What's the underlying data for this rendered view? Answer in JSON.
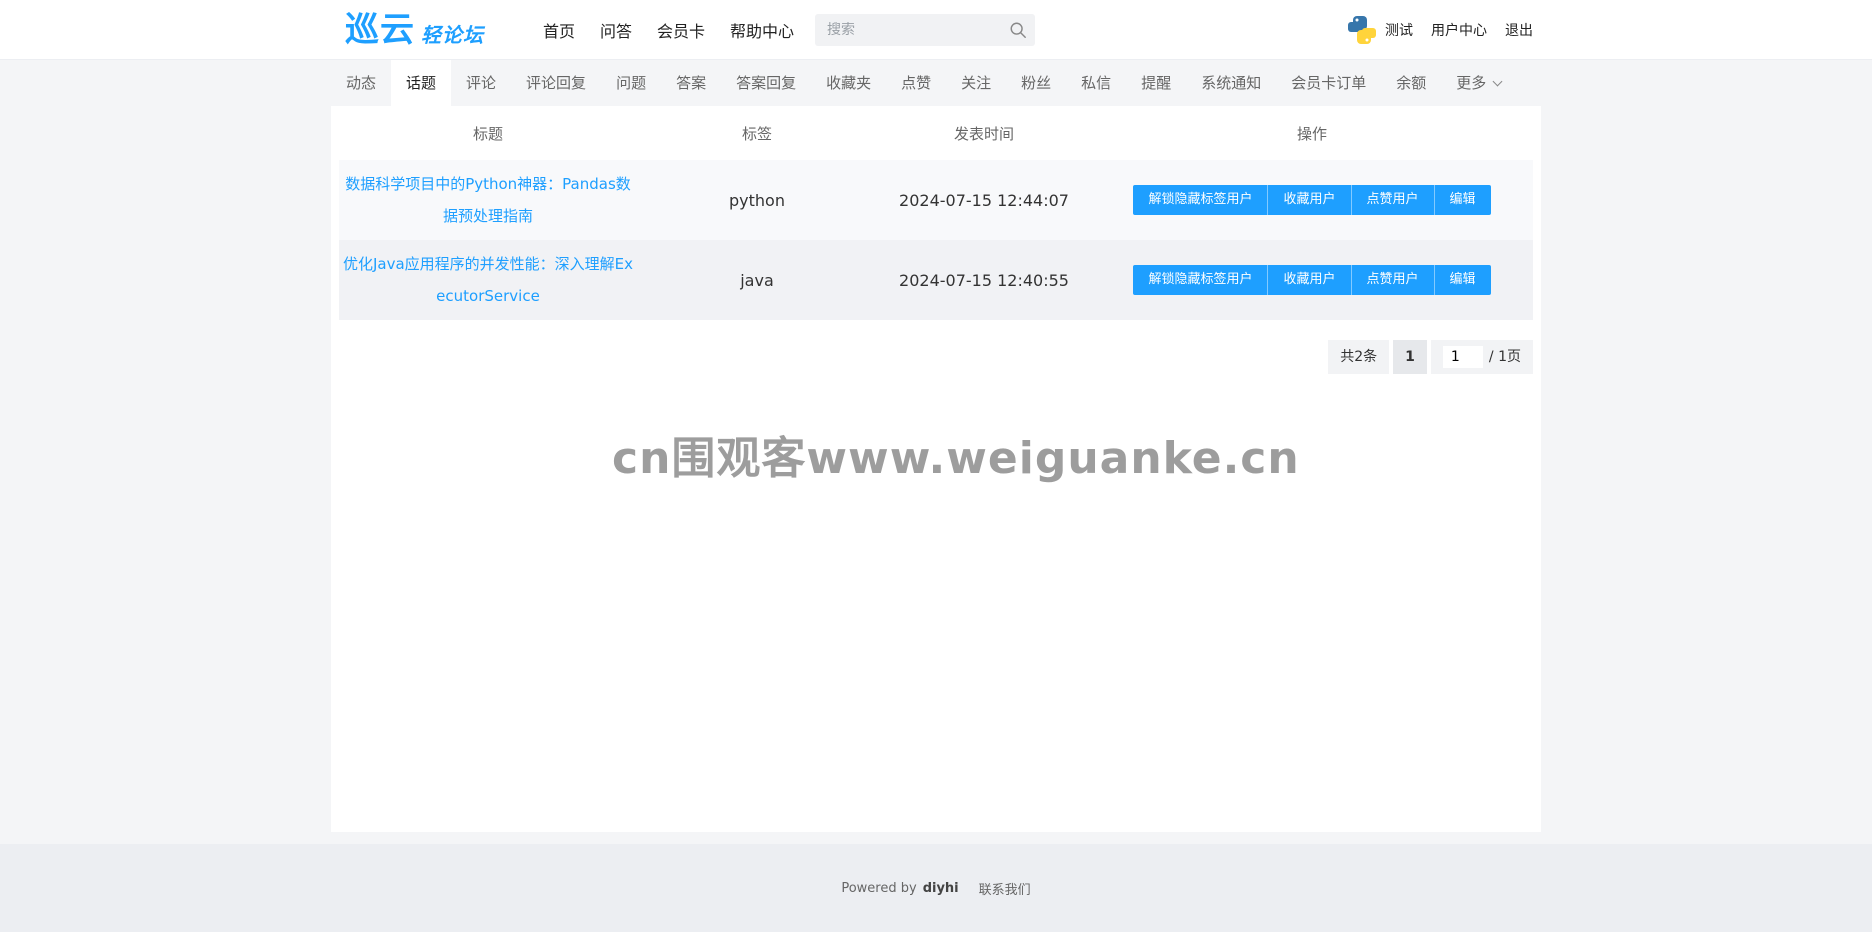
{
  "header": {
    "logo_main": "巡云",
    "logo_sub": "轻论坛",
    "nav": [
      "首页",
      "问答",
      "会员卡",
      "帮助中心"
    ],
    "search_placeholder": "搜索",
    "user_name": "测试",
    "user_center": "用户中心",
    "logout": "退出"
  },
  "tabs": [
    {
      "label": "动态",
      "active": false
    },
    {
      "label": "话题",
      "active": true
    },
    {
      "label": "评论",
      "active": false
    },
    {
      "label": "评论回复",
      "active": false
    },
    {
      "label": "问题",
      "active": false
    },
    {
      "label": "答案",
      "active": false
    },
    {
      "label": "答案回复",
      "active": false
    },
    {
      "label": "收藏夹",
      "active": false
    },
    {
      "label": "点赞",
      "active": false
    },
    {
      "label": "关注",
      "active": false
    },
    {
      "label": "粉丝",
      "active": false
    },
    {
      "label": "私信",
      "active": false
    },
    {
      "label": "提醒",
      "active": false
    },
    {
      "label": "系统通知",
      "active": false
    },
    {
      "label": "会员卡订单",
      "active": false
    },
    {
      "label": "余额",
      "active": false
    },
    {
      "label": "更多",
      "active": false
    }
  ],
  "table": {
    "headers": {
      "title": "标题",
      "tag": "标签",
      "time": "发表时间",
      "ops": "操作"
    },
    "rows": [
      {
        "title": "数据科学项目中的Python神器：Pandas数据预处理指南",
        "tag": "python",
        "time": "2024-07-15 12:44:07"
      },
      {
        "title": "优化Java应用程序的并发性能：深入理解ExecutorService",
        "tag": "java",
        "time": "2024-07-15 12:40:55"
      }
    ],
    "ops": [
      "解锁隐藏标签用户",
      "收藏用户",
      "点赞用户",
      "编辑"
    ]
  },
  "pager": {
    "total": "共2条",
    "current": "1",
    "jump_value": "1",
    "pages_suffix": "/ 1页"
  },
  "watermark": "cn围观客www.weiguanke.cn",
  "footer": {
    "powered": "Powered by",
    "brand": "diyhi",
    "contact": "联系我们"
  },
  "colors": {
    "accent": "#1e9fff",
    "background": "#f4f5f7"
  }
}
